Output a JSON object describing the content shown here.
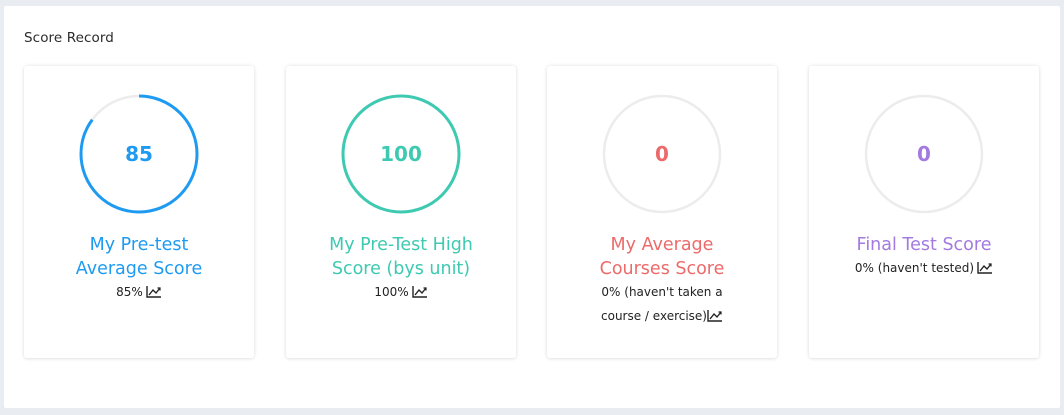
{
  "section": {
    "title": "Score Record"
  },
  "cards": [
    {
      "value": "85",
      "title_line1": "My Pre-test",
      "title_line2": "Average Score",
      "sub_line1": "85%",
      "sub_line2": "",
      "progress": 0.85,
      "color": "#1e9bf0"
    },
    {
      "value": "100",
      "title_line1": "My Pre-Test High",
      "title_line2": "Score (bys unit)",
      "sub_line1": "100%",
      "sub_line2": "",
      "progress": 1.0,
      "color": "#3ec9b1"
    },
    {
      "value": "0",
      "title_line1": "My Average",
      "title_line2": "Courses Score",
      "sub_line1": "0% (haven't taken a",
      "sub_line2": "course / exercise)",
      "progress": 0,
      "color": "#ec6a6a"
    },
    {
      "value": "0",
      "title_line1": "Final Test Score",
      "title_line2": "",
      "sub_line1": "0% (haven't tested)",
      "sub_line2": "",
      "progress": 0,
      "color": "#a27ae0"
    }
  ],
  "icons": {
    "trend": "line-chart-icon"
  },
  "colors": {
    "track": "#ececec"
  }
}
